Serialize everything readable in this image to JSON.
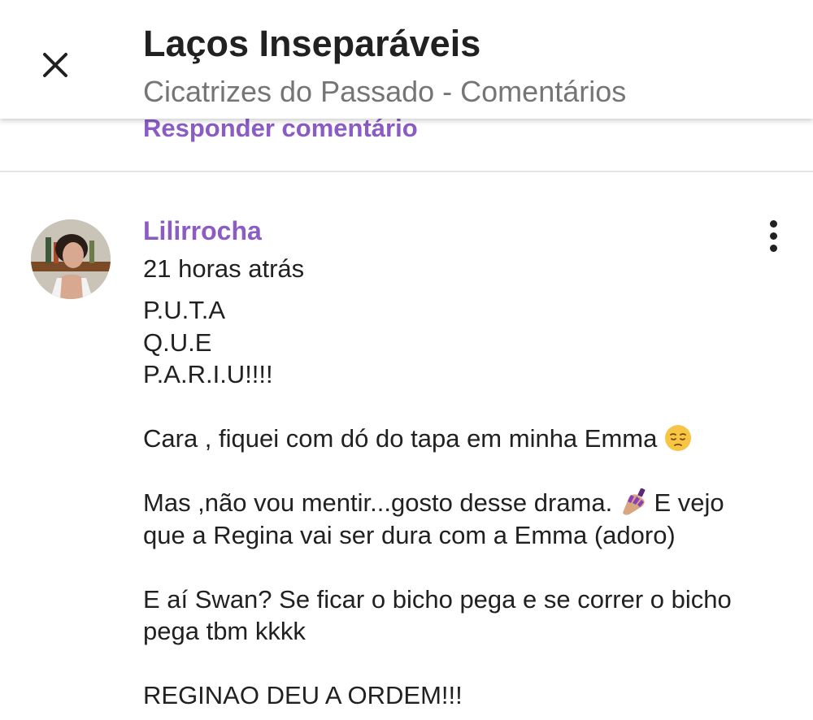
{
  "header": {
    "title": "Laços Inseparáveis",
    "subtitle": "Cicatrizes do Passado - Comentários",
    "close_icon": "close-icon"
  },
  "reply_link": "Responder comentário",
  "colors": {
    "accent": "#8a5cc4",
    "text": "#212121",
    "muted": "#757575",
    "divider": "#e4e4e4"
  },
  "comment": {
    "author": "Lilirrocha",
    "time": "21 horas atrás",
    "menu_icon": "more-vertical-icon",
    "lines": {
      "l1": "P.U.T.A",
      "l2": "Q.U.E",
      "l3": "P.A.R.I.U!!!!",
      "l4": "Cara , fiquei com dó do tapa em minha Emma",
      "l5a": "Mas ,não vou mentir...gosto desse drama.",
      "l5b": "E vejo",
      "l6": "que a Regina vai ser dura com a Emma (adoro)",
      "l7": "E aí Swan? Se ficar o bicho pega e se correr o bicho",
      "l8": "pega tbm kkkk",
      "l9": "REGINAO DEU A ORDEM!!!"
    },
    "emojis": [
      "pensive-face-emoji",
      "nail-polish-emoji"
    ]
  }
}
